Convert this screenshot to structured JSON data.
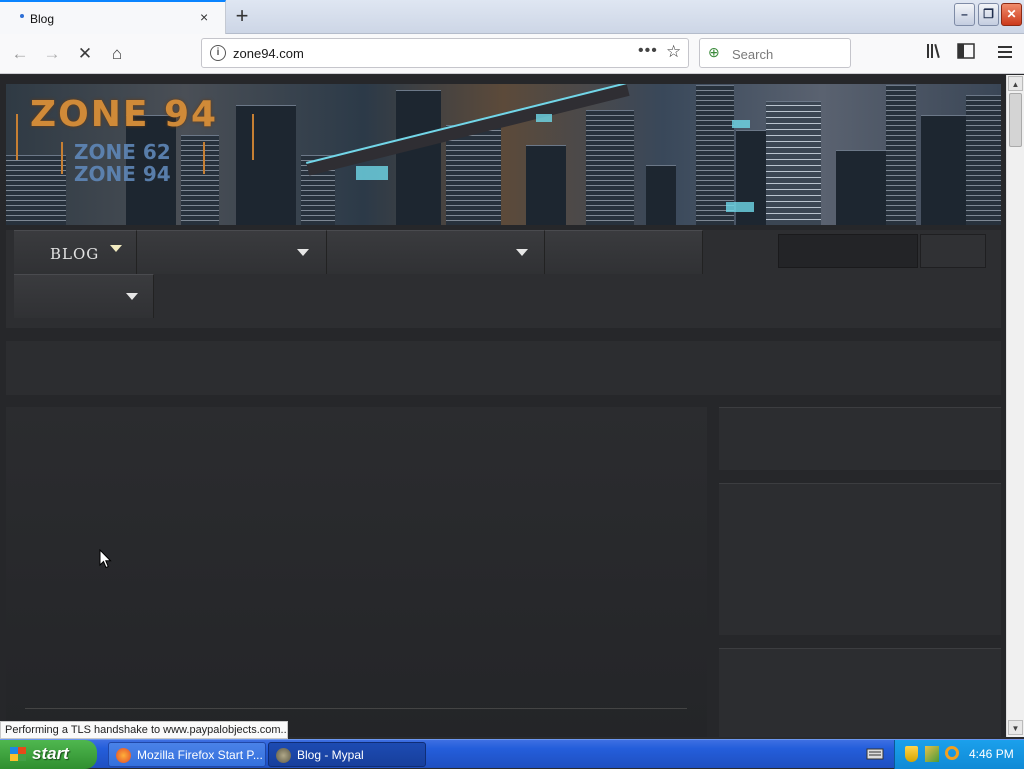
{
  "browser": {
    "tab": {
      "title": "Blog",
      "close": "×"
    },
    "new_tab": "+",
    "window_controls": {
      "minimize": "–",
      "restore": "❐",
      "close": "✕"
    },
    "nav": {
      "back": "←",
      "forward": "→",
      "stop": "✕",
      "home": "⌂"
    },
    "url": "zone94.com",
    "url_actions": {
      "more": "•••",
      "bookmark": "☆"
    },
    "search": {
      "placeholder": "Search"
    },
    "toolbar_icons": {
      "library": "library-icon",
      "sidebar": "sidebar-icon",
      "menu": "hamburger-menu-icon"
    }
  },
  "site": {
    "logo": {
      "main": "ZONE 94",
      "sub1": "ZONE 62",
      "sub2": "ZONE 94"
    },
    "menu": {
      "items": [
        {
          "label": "BLOG"
        },
        {
          "label": ""
        },
        {
          "label": ""
        },
        {
          "label": ""
        },
        {
          "label": ""
        }
      ]
    }
  },
  "status_text": "Performing a TLS handshake to www.paypalobjects.com...",
  "taskbar": {
    "start": "start",
    "tasks": [
      {
        "label": "Mozilla Firefox Start P..."
      },
      {
        "label": "Blog - Mypal"
      }
    ],
    "clock": "4:46 PM"
  },
  "colors": {
    "accent": "#0a84ff",
    "logo_orange": "#d08a38",
    "page_bg": "#26272a"
  }
}
